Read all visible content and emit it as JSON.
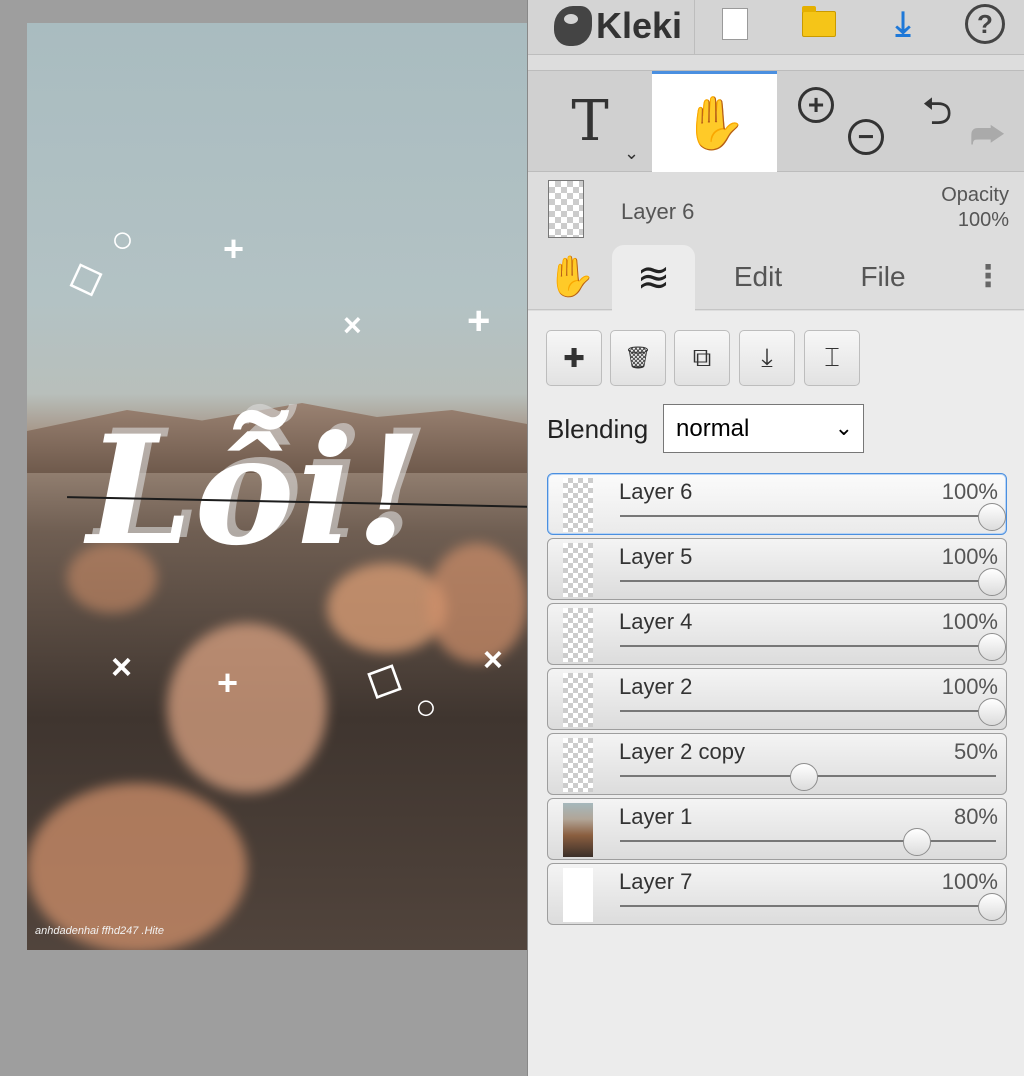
{
  "app": {
    "name": "Kleki"
  },
  "canvas": {
    "title_text": "Lỗi!",
    "watermark": "anhdadenhai ffhd247 .Hite"
  },
  "toolbar": {
    "new_icon": "new-file-icon",
    "open_icon": "open-folder-icon",
    "save_icon": "download-icon",
    "help_glyph": "?"
  },
  "tools": {
    "text_glyph": "T",
    "text_chevron": "⌄",
    "hand_glyph": "✋",
    "zoom_in": "+",
    "zoom_out": "−",
    "undo": "⮌",
    "redo": "⮫"
  },
  "current_layer": {
    "name": "Layer 6",
    "opacity_label": "Opacity",
    "opacity_value": "100%"
  },
  "tabs": {
    "hand": "✋",
    "layers": "≋",
    "edit": "Edit",
    "file": "File",
    "more": "⋮"
  },
  "layer_actions": {
    "add": "✚",
    "delete": "🗑",
    "duplicate": "⧉",
    "merge": "⤓",
    "rename": "⌶"
  },
  "blending": {
    "label": "Blending",
    "value": "normal",
    "chevron": "⌄"
  },
  "layers": [
    {
      "name": "Layer 6",
      "opacity": "100%",
      "level": 1.0,
      "thumb": "transparent",
      "selected": true
    },
    {
      "name": "Layer 5",
      "opacity": "100%",
      "level": 1.0,
      "thumb": "transparent",
      "selected": false
    },
    {
      "name": "Layer 4",
      "opacity": "100%",
      "level": 1.0,
      "thumb": "transparent",
      "selected": false
    },
    {
      "name": "Layer 2",
      "opacity": "100%",
      "level": 1.0,
      "thumb": "transparent",
      "selected": false
    },
    {
      "name": "Layer 2 copy",
      "opacity": "50%",
      "level": 0.5,
      "thumb": "transparent",
      "selected": false
    },
    {
      "name": "Layer 1",
      "opacity": "80%",
      "level": 0.8,
      "thumb": "photo",
      "selected": false
    },
    {
      "name": "Layer 7",
      "opacity": "100%",
      "level": 1.0,
      "thumb": "white",
      "selected": false
    }
  ],
  "colors": {
    "accent": "#4a8fe0",
    "download": "#1e78d8",
    "folder": "#f5c518"
  }
}
